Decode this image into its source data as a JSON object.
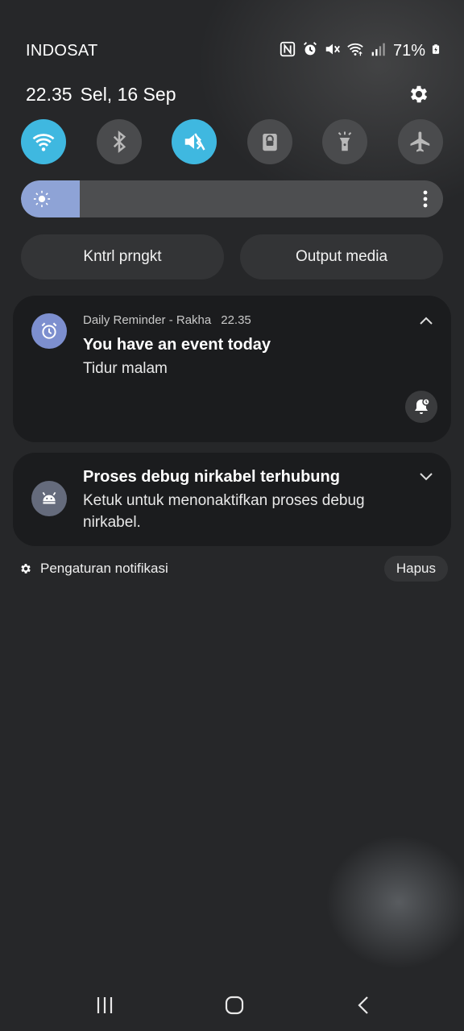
{
  "status_bar": {
    "carrier": "INDOSAT",
    "battery_percent": "71%",
    "icons": [
      "nfc-icon",
      "alarm-icon",
      "mute-icon",
      "wifi-icon",
      "signal-icon",
      "battery-icon"
    ]
  },
  "header": {
    "time": "22.35",
    "date": "Sel, 16 Sep",
    "settings_icon": "gear-icon"
  },
  "quick_settings": {
    "tiles": [
      {
        "name": "wifi",
        "icon": "wifi-icon",
        "active": true
      },
      {
        "name": "bluetooth",
        "icon": "bluetooth-icon",
        "active": false
      },
      {
        "name": "sound",
        "icon": "mute-icon",
        "active": true
      },
      {
        "name": "screen-lock",
        "icon": "lock-icon",
        "active": false
      },
      {
        "name": "flashlight",
        "icon": "flashlight-icon",
        "active": false
      },
      {
        "name": "airplane-mode",
        "icon": "airplane-icon",
        "active": false
      }
    ],
    "brightness_level": 0.14,
    "accent_color": "#3fb8e0",
    "brightness_color": "#8ea3d6"
  },
  "controls": {
    "device_control_label": "Kntrl prngkt",
    "media_output_label": "Output media"
  },
  "notifications": [
    {
      "app": "Daily Reminder - Rakha",
      "time": "22.35",
      "title": "You have an event today",
      "text": "Tidur malam",
      "icon": "alarm-icon",
      "icon_color": "#7d8fcf",
      "expanded": true
    },
    {
      "title": "Proses debug nirkabel terhubung",
      "text_line1": "Ketuk untuk menonaktifkan proses debug",
      "text_line2": "nirkabel.",
      "icon": "android-debug-icon",
      "icon_color": "#656b7c",
      "expanded": false
    }
  ],
  "footer": {
    "settings_label": "Pengaturan notifikasi",
    "clear_label": "Hapus"
  },
  "nav": {
    "recents_icon": "recents-icon",
    "home_icon": "home-icon",
    "back_icon": "back-icon"
  }
}
